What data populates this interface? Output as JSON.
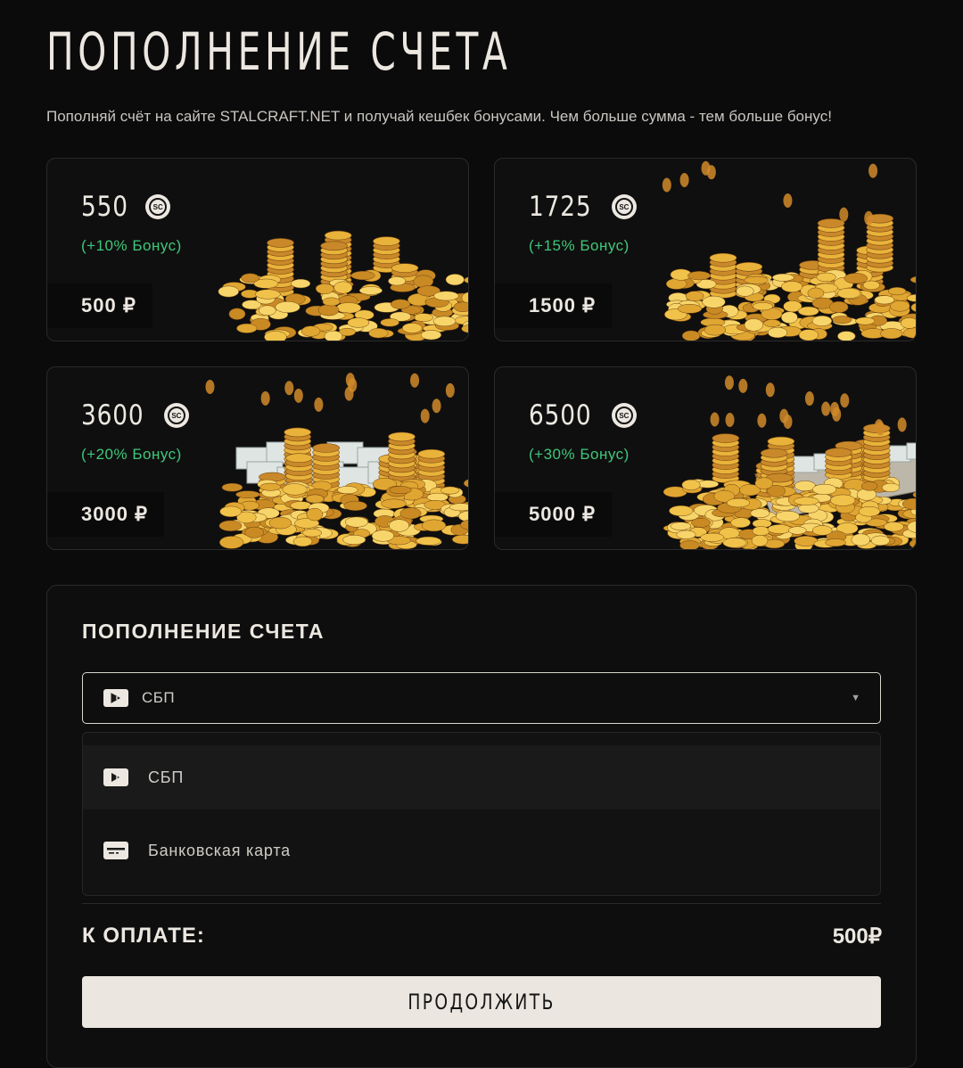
{
  "page": {
    "title": "ПОПОЛНЕНИЕ СЧЕТА",
    "subtitle": "Пополняй счёт на сайте STALCRAFT.NET и получай кешбек бонусами. Чем больше сумма - тем больше бонус!"
  },
  "packs": [
    {
      "amount": "550",
      "bonus": "(+10% Бонус)",
      "price": "500 ₽",
      "currency_icon": "sc-coin-icon"
    },
    {
      "amount": "1725",
      "bonus": "(+15% Бонус)",
      "price": "1500 ₽",
      "currency_icon": "sc-coin-icon"
    },
    {
      "amount": "3600",
      "bonus": "(+20% Бонус)",
      "price": "3000 ₽",
      "currency_icon": "sc-coin-icon"
    },
    {
      "amount": "6500",
      "bonus": "(+30% Бонус)",
      "price": "5000 ₽",
      "currency_icon": "sc-coin-icon"
    }
  ],
  "payment": {
    "title": "ПОПОЛНЕНИЕ СЧЕТА",
    "selected": "СБП",
    "options": [
      {
        "label": "СБП",
        "icon": "sbp-icon",
        "selected": true
      },
      {
        "label": "Банковская карта",
        "icon": "bank-card-icon",
        "selected": false
      }
    ],
    "total_label": "К ОПЛАТЕ:",
    "total_value": "500₽",
    "continue_label": "ПРОДОЛЖИТЬ"
  },
  "colors": {
    "background": "#0b0b0b",
    "bonus_green": "#3fc77a",
    "button_bg": "#ebe6df",
    "coin_gold": "#e9b23a"
  }
}
